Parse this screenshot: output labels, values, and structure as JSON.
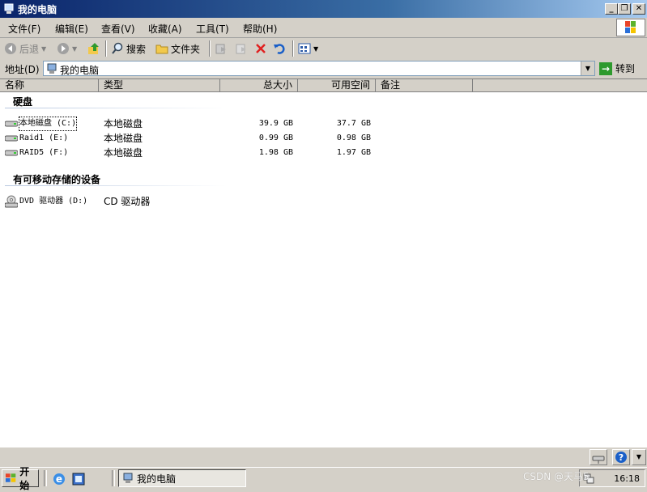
{
  "window": {
    "title": "我的电脑",
    "minimize": "_",
    "restore": "❐",
    "close": "✕"
  },
  "menu": {
    "items": [
      "文件(F)",
      "编辑(E)",
      "查看(V)",
      "收藏(A)",
      "工具(T)",
      "帮助(H)"
    ]
  },
  "toolbar": {
    "back": "后退",
    "search": "搜索",
    "folders": "文件夹"
  },
  "address": {
    "label": "地址(D)",
    "value": "我的电脑",
    "go": "转到"
  },
  "columns": [
    "名称",
    "类型",
    "总大小",
    "可用空间",
    "备注"
  ],
  "groups": [
    {
      "title": "硬盘",
      "items": [
        {
          "name": "本地磁盘 (C:)",
          "type": "本地磁盘",
          "total": "39.9 GB",
          "free": "37.7 GB"
        },
        {
          "name": "Raid1 (E:)",
          "type": "本地磁盘",
          "total": "0.99 GB",
          "free": "0.98 GB"
        },
        {
          "name": "RAID5 (F:)",
          "type": "本地磁盘",
          "total": "1.98 GB",
          "free": "1.97 GB"
        }
      ]
    },
    {
      "title": "有可移动存储的设备",
      "items": [
        {
          "name": "DVD 驱动器 (D:)",
          "type": "CD 驱动器",
          "total": "",
          "free": ""
        }
      ]
    }
  ],
  "taskbar": {
    "start": "开始",
    "task": "我的电脑",
    "clock": "16:18"
  },
  "watermark": "CSDN @天马5"
}
